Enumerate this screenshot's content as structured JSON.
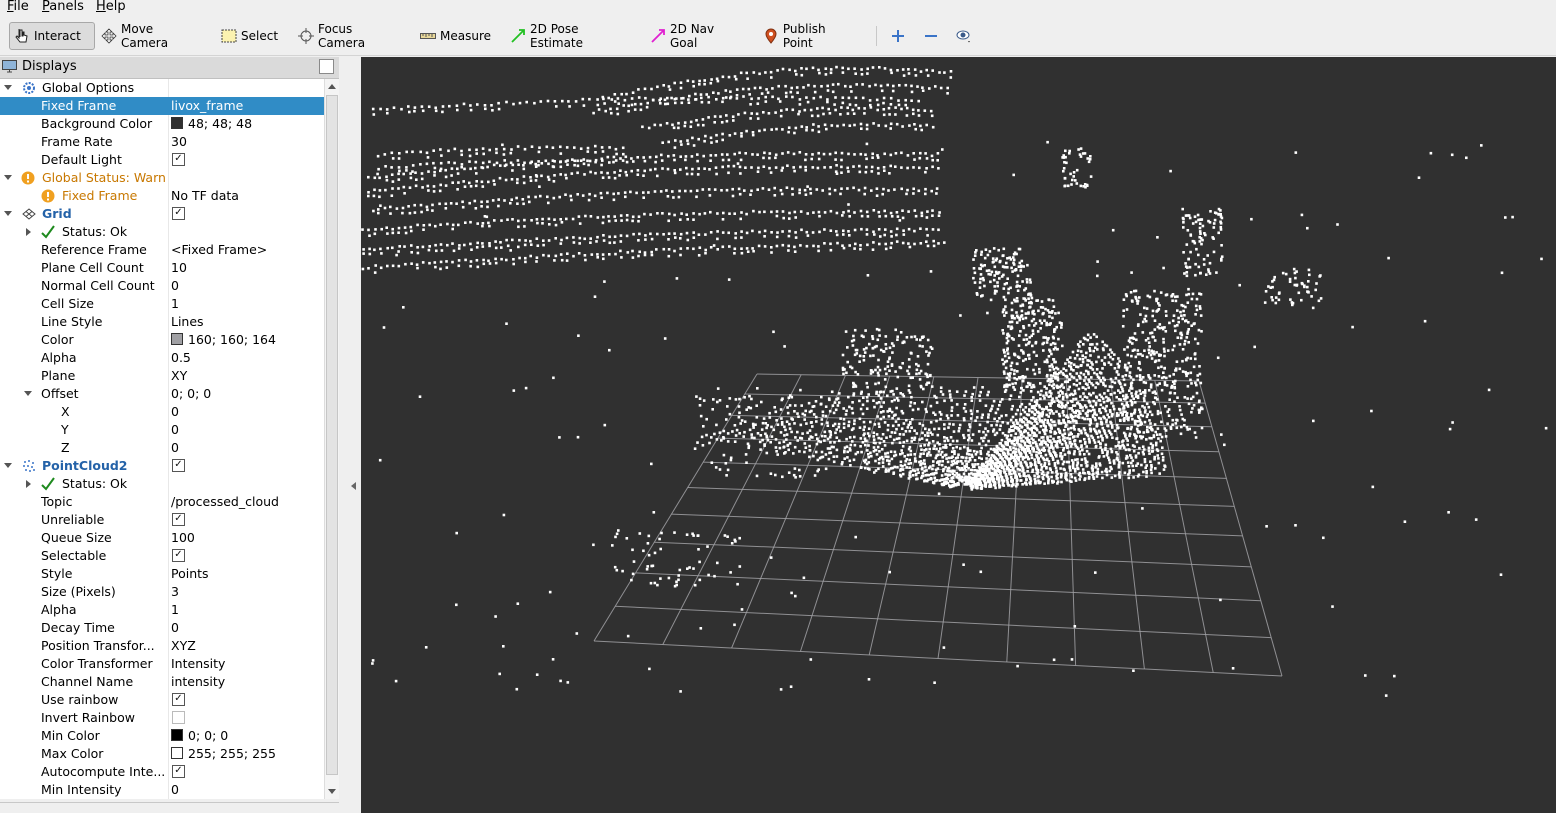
{
  "menu": [
    "File",
    "Panels",
    "Help"
  ],
  "toolbar": {
    "interact": "Interact",
    "move_camera": "Move Camera",
    "select": "Select",
    "focus_camera": "Focus Camera",
    "measure": "Measure",
    "pose_estimate": "2D Pose Estimate",
    "nav_goal": "2D Nav Goal",
    "publish_point": "Publish Point"
  },
  "displays": {
    "title": "Displays",
    "rows": [
      {
        "name": "Global Options",
        "value": ""
      },
      {
        "name": "Fixed Frame",
        "value": "livox_frame"
      },
      {
        "name": "Background Color",
        "value": "48; 48; 48"
      },
      {
        "name": "Frame Rate",
        "value": "30"
      },
      {
        "name": "Default Light",
        "value": ""
      },
      {
        "name": "Global Status: Warn",
        "value": ""
      },
      {
        "name": "Fixed Frame",
        "value": "No TF data"
      },
      {
        "name": "Grid",
        "value": ""
      },
      {
        "name": "Status: Ok",
        "value": ""
      },
      {
        "name": "Reference Frame",
        "value": "<Fixed Frame>"
      },
      {
        "name": "Plane Cell Count",
        "value": "10"
      },
      {
        "name": "Normal Cell Count",
        "value": "0"
      },
      {
        "name": "Cell Size",
        "value": "1"
      },
      {
        "name": "Line Style",
        "value": "Lines"
      },
      {
        "name": "Color",
        "value": "160; 160; 164"
      },
      {
        "name": "Alpha",
        "value": "0.5"
      },
      {
        "name": "Plane",
        "value": "XY"
      },
      {
        "name": "Offset",
        "value": "0; 0; 0"
      },
      {
        "name": "X",
        "value": "0"
      },
      {
        "name": "Y",
        "value": "0"
      },
      {
        "name": "Z",
        "value": "0"
      },
      {
        "name": "PointCloud2",
        "value": ""
      },
      {
        "name": "Status: Ok",
        "value": ""
      },
      {
        "name": "Topic",
        "value": "/processed_cloud"
      },
      {
        "name": "Unreliable",
        "value": ""
      },
      {
        "name": "Queue Size",
        "value": "100"
      },
      {
        "name": "Selectable",
        "value": ""
      },
      {
        "name": "Style",
        "value": "Points"
      },
      {
        "name": "Size (Pixels)",
        "value": "3"
      },
      {
        "name": "Alpha",
        "value": "1"
      },
      {
        "name": "Decay Time",
        "value": "0"
      },
      {
        "name": "Position Transfor...",
        "value": "XYZ"
      },
      {
        "name": "Color Transformer",
        "value": "Intensity"
      },
      {
        "name": "Channel Name",
        "value": "intensity"
      },
      {
        "name": "Use rainbow",
        "value": ""
      },
      {
        "name": "Invert Rainbow",
        "value": ""
      },
      {
        "name": "Min Color",
        "value": "0; 0; 0"
      },
      {
        "name": "Max Color",
        "value": "255; 255; 255"
      },
      {
        "name": "Autocompute Inte...",
        "value": ""
      },
      {
        "name": "Min Intensity",
        "value": "0"
      }
    ]
  },
  "colors": {
    "viewport_bg": "#303030",
    "selection": "#308cc6",
    "warn": "#c87800",
    "grid_line": "#a0a0a4",
    "points": "#ffffff"
  },
  "icons": [
    "pointer-icon",
    "move-camera-icon",
    "select-box-icon",
    "focus-camera-icon",
    "ruler-icon",
    "green-arrow-icon",
    "magenta-arrow-icon",
    "map-pin-icon",
    "plus-icon",
    "minus-icon",
    "eye-icon"
  ]
}
